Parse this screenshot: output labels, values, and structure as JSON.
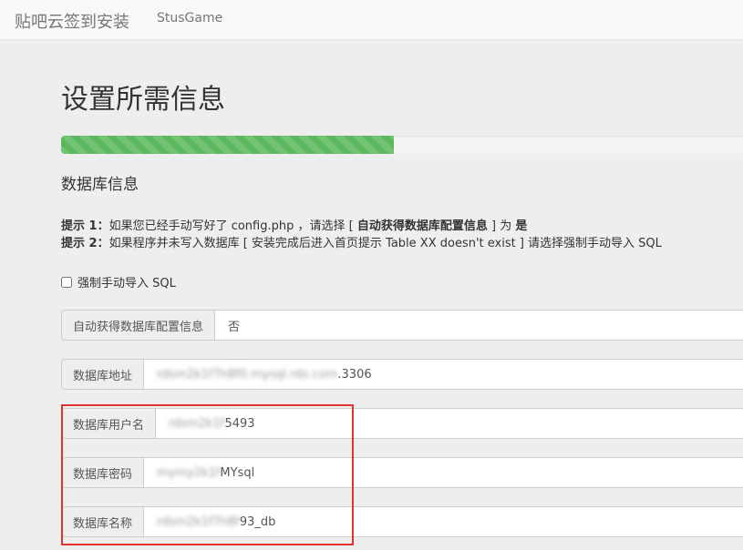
{
  "navbar": {
    "brand": "贴吧云签到安装",
    "link": "StusGame"
  },
  "page": {
    "title": "设置所需信息",
    "progress_percent": 48,
    "section_title": "数据库信息"
  },
  "tips": {
    "tip1_label": "提示 1：",
    "tip1_text": "如果您已经手动写好了 config.php ，请选择 [ ",
    "tip1_bold": "自动获得数据库配置信息",
    "tip1_mid": " ] 为 ",
    "tip1_value": "是",
    "tip2_label": "提示 2：",
    "tip2_text": "如果程序并未写入数据库 [ 安装完成后进入首页提示 Table XX doesn't exist ] 请选择强制手动导入 SQL"
  },
  "force_sql": {
    "label": "强制手动导入 SQL",
    "checked": false
  },
  "fields": {
    "auto": {
      "label": "自动获得数据库配置信息",
      "value": "否"
    },
    "host": {
      "label": "数据库地址",
      "masked": "rdsm2k1f7h8f0.mysql.rds.com",
      "value_tail": ".3306"
    },
    "user": {
      "label": "数据库用户名",
      "masked": "rdsm2k1f",
      "value_tail": "5493"
    },
    "password": {
      "label": "数据库密码",
      "masked": "mymy2k1f",
      "value_tail": "MYsql"
    },
    "dbname": {
      "label": "数据库名称",
      "masked": "rdsm2k1f7h8f",
      "value_tail": "93_db"
    }
  },
  "colors": {
    "progress": "#5cb85c",
    "highlight": "#e0342f"
  }
}
